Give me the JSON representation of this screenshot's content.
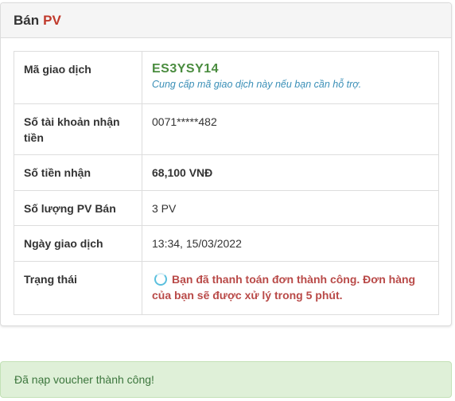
{
  "panel": {
    "title_prefix": "Bán",
    "title_accent": "PV"
  },
  "rows": {
    "transaction_code": {
      "label": "Mã giao dịch",
      "value": "ES3YSY14",
      "hint": "Cung cấp mã giao dịch này nếu bạn cần hỗ trợ."
    },
    "account_number": {
      "label": "Số tài khoản nhận tiền",
      "value": "0071*****482"
    },
    "amount": {
      "label": "Số tiền nhận",
      "value": "68,100 VNĐ"
    },
    "pv_quantity": {
      "label": "Số lượng PV Bán",
      "value": "3 PV"
    },
    "date": {
      "label": "Ngày giao dịch",
      "value": "13:34, 15/03/2022"
    },
    "status": {
      "label": "Trạng thái",
      "value": "Bạn đã thanh toán đơn thành công. Đơn hàng của bạn sẽ được xử lý trong 5 phút.",
      "icon": "loading-spinner-icon"
    }
  },
  "alert": {
    "message": "Đã nạp voucher thành công!"
  },
  "colors": {
    "accent": "#c0392b",
    "code": "#4a8c3f",
    "hint": "#3a8fb7",
    "status": "#b94a48",
    "alert_bg": "#dff0d8"
  }
}
